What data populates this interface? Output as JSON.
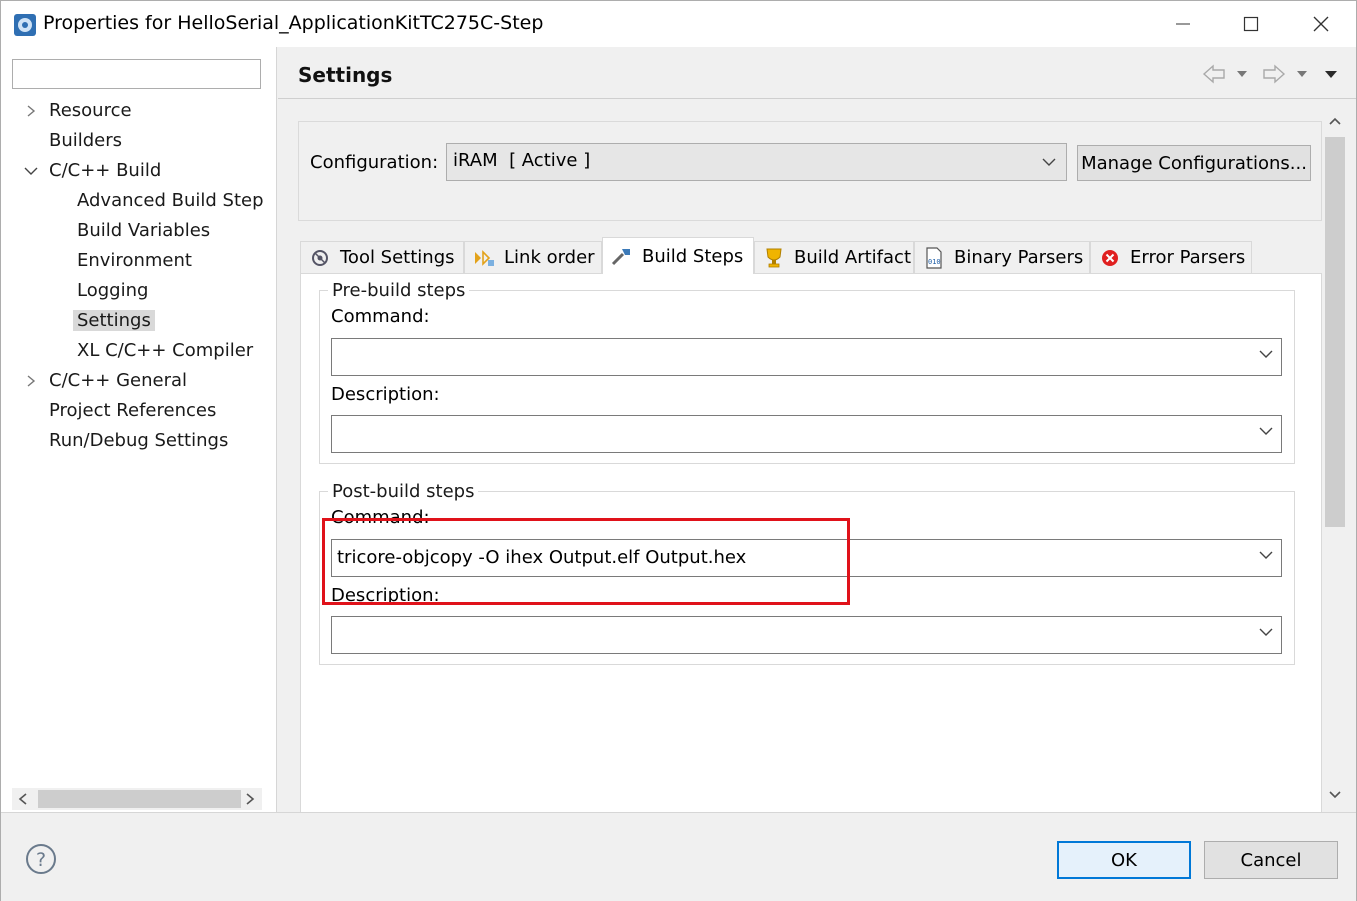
{
  "window": {
    "title": "Properties for HelloSerial_ApplicationKitTC275C-Step"
  },
  "filter": {
    "value": ""
  },
  "tree": {
    "items": [
      {
        "label": "Resource",
        "arrow": "right"
      },
      {
        "label": "Builders",
        "arrow": ""
      },
      {
        "label": "C/C++ Build",
        "arrow": "down"
      },
      {
        "label": "Advanced Build Steps"
      },
      {
        "label": "Build Variables"
      },
      {
        "label": "Environment"
      },
      {
        "label": "Logging"
      },
      {
        "label": "Settings",
        "selected": true
      },
      {
        "label": "XL C/C++ Compiler"
      },
      {
        "label": "C/C++ General",
        "arrow": "right"
      },
      {
        "label": "Project References",
        "arrow": ""
      },
      {
        "label": "Run/Debug Settings",
        "arrow": ""
      }
    ]
  },
  "header": {
    "title": "Settings",
    "icons": [
      "back-arrow-icon",
      "dropdown-icon",
      "forward-arrow-icon",
      "dropdown-icon",
      "view-menu-icon"
    ]
  },
  "configuration": {
    "label": "Configuration:",
    "value": "iRAM  [ Active ]",
    "manage_label": "Manage Configurations..."
  },
  "tabs": [
    {
      "label": "Tool Settings",
      "icon": "tool-settings-icon"
    },
    {
      "label": "Link order",
      "icon": "link-order-icon"
    },
    {
      "label": "Build Steps",
      "icon": "build-steps-icon",
      "active": true
    },
    {
      "label": "Build Artifact",
      "icon": "build-artifact-icon"
    },
    {
      "label": "Binary Parsers",
      "icon": "binary-parsers-icon"
    },
    {
      "label": "Error Parsers",
      "icon": "error-parsers-icon"
    }
  ],
  "pre_build": {
    "legend": "Pre-build steps",
    "command_label": "Command:",
    "command_value": "",
    "description_label": "Description:",
    "description_value": ""
  },
  "post_build": {
    "legend": "Post-build steps",
    "command_label": "Command:",
    "command_value": "tricore-objcopy -O ihex Output.elf Output.hex",
    "description_label": "Description:",
    "description_value": ""
  },
  "buttons": {
    "ok": "OK",
    "cancel": "Cancel"
  },
  "colors": {
    "highlight": "#e0121a",
    "ok_border": "#0078d7"
  }
}
